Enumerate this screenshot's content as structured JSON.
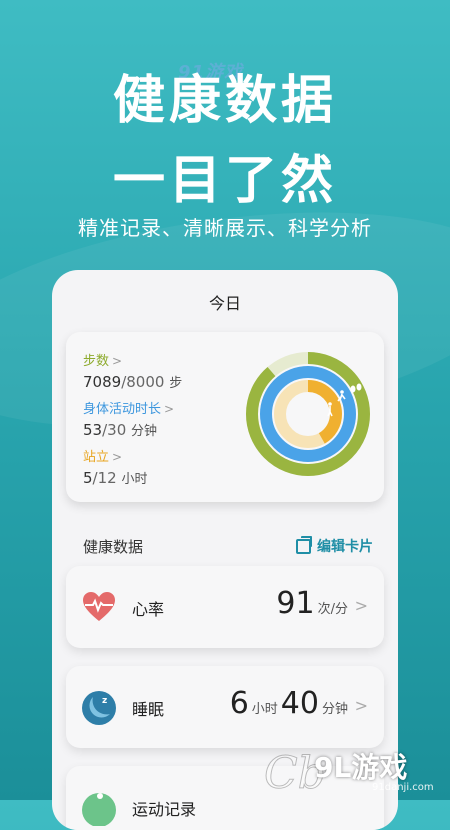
{
  "hero": {
    "line1": "健康数据",
    "line2": "一目了然",
    "subtitle": "精准记录、清晰展示、科学分析"
  },
  "watermark_top": "91游戏",
  "phone": {
    "title": "今日",
    "activity": {
      "steps": {
        "label": "步数",
        "value": "7089",
        "goal": "/8000",
        "unit": "步",
        "progress": 0.886,
        "color": "#9ab540"
      },
      "active": {
        "label": "身体活动时长",
        "value": "53",
        "goal": "/30",
        "unit": "分钟",
        "progress": 1.0,
        "color": "#4aa3e8"
      },
      "stand": {
        "label": "站立",
        "value": "5",
        "goal": "/12",
        "unit": "小时",
        "progress": 0.417,
        "color": "#f0b030"
      }
    },
    "section": {
      "title": "健康数据",
      "edit_label": "编辑卡片"
    },
    "cards": {
      "heart": {
        "label": "心率",
        "value": "91",
        "unit": "次/分"
      },
      "sleep": {
        "label": "睡眠",
        "hours": "6",
        "hours_unit": "小时",
        "minutes": "40",
        "minutes_unit": "分钟"
      },
      "exercise": {
        "label": "运动记录"
      }
    }
  },
  "brand": {
    "logo": "9L游戏",
    "site": "91danji.com"
  },
  "colors": {
    "accent": "#1f8ea6",
    "bg": "#2aa7b0",
    "heart": "#e46a6a",
    "sleep": "#2e7ea8"
  }
}
